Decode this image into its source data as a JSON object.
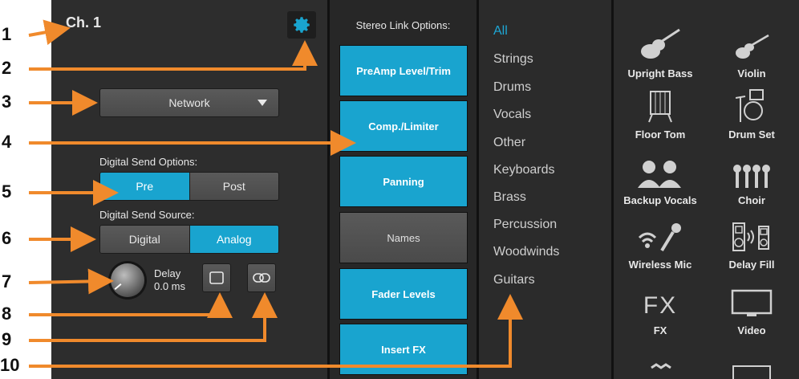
{
  "channel": {
    "title": "Ch. 1"
  },
  "source_dropdown": {
    "value": "Network"
  },
  "digital_send_options": {
    "label": "Digital Send Options:",
    "options": [
      "Pre",
      "Post"
    ],
    "selected": "Pre"
  },
  "digital_send_source": {
    "label": "Digital Send Source:",
    "options": [
      "Digital",
      "Analog"
    ],
    "selected": "Analog"
  },
  "delay": {
    "label": "Delay",
    "value": "0.0 ms"
  },
  "stereo_link": {
    "title": "Stereo Link Options:",
    "buttons": [
      {
        "label": "PreAmp Level/Trim",
        "on": true
      },
      {
        "label": "Comp./Limiter",
        "on": true
      },
      {
        "label": "Panning",
        "on": true
      },
      {
        "label": "Names",
        "on": false
      },
      {
        "label": "Fader Levels",
        "on": true
      },
      {
        "label": "Insert FX",
        "on": true
      }
    ]
  },
  "categories": {
    "selected": "All",
    "items": [
      "All",
      "Strings",
      "Drums",
      "Vocals",
      "Other",
      "Keyboards",
      "Brass",
      "Percussion",
      "Woodwinds",
      "Guitars"
    ]
  },
  "instruments": [
    {
      "name": "Upright Bass",
      "icon": "upright-bass-icon"
    },
    {
      "name": "Violin",
      "icon": "violin-icon"
    },
    {
      "name": "Floor Tom",
      "icon": "floor-tom-icon"
    },
    {
      "name": "Drum Set",
      "icon": "drum-set-icon"
    },
    {
      "name": "Backup Vocals",
      "icon": "backup-vocals-icon"
    },
    {
      "name": "Choir",
      "icon": "choir-icon"
    },
    {
      "name": "Wireless Mic",
      "icon": "wireless-mic-icon"
    },
    {
      "name": "Delay Fill",
      "icon": "delay-fill-icon"
    },
    {
      "name": "FX",
      "icon": "fx-icon",
      "glyph": "FX"
    },
    {
      "name": "Video",
      "icon": "video-icon"
    }
  ],
  "callouts": [
    "1",
    "2",
    "3",
    "4",
    "5",
    "6",
    "7",
    "8",
    "9",
    "10"
  ],
  "colors": {
    "accent": "#19a4cf",
    "callout_arrow": "#f08a2c",
    "background": "#2b2b2b"
  }
}
